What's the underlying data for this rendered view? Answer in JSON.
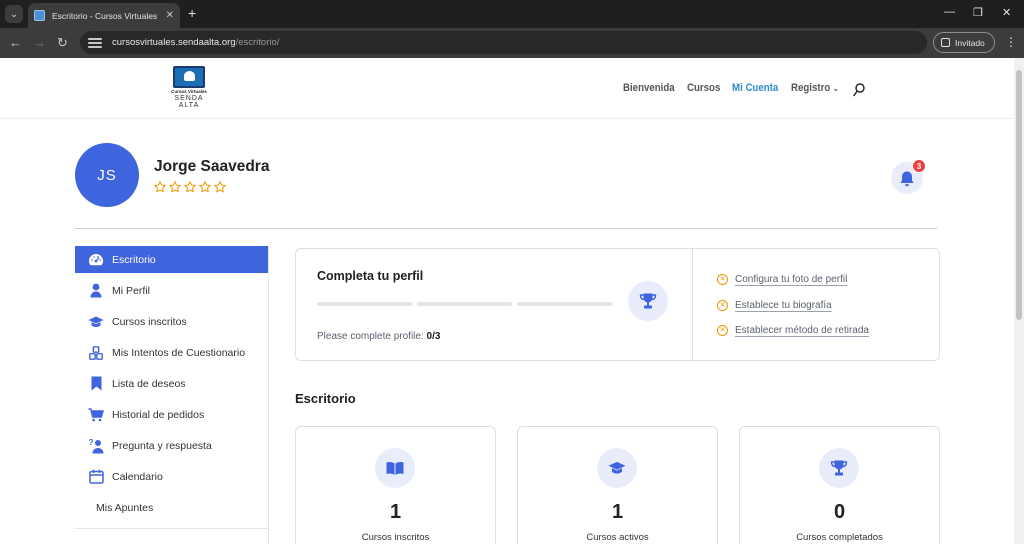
{
  "browser": {
    "tab_title": "Escritorio - Cursos Virtuales Sen",
    "url_host": "cursosvirtuales.sendaalta.org",
    "url_path": "/escritorio/",
    "profile_label": "Invitado"
  },
  "site": {
    "logo_line1": "Cursos Virtuales",
    "logo_line2": "SENDA",
    "logo_line3": "ALTA",
    "menu": [
      "Bienvenida",
      "Cursos",
      "Mi Cuenta",
      "Registro"
    ],
    "active_menu": "Mi Cuenta",
    "accent_color": "#3e64de"
  },
  "user": {
    "initials": "JS",
    "name": "Jorge Saavedra",
    "rating_stars": 0,
    "rating_max": 5,
    "notifications": "3"
  },
  "sidebar": {
    "items": [
      {
        "label": "Escritorio",
        "icon": "dashboard-icon",
        "active": true
      },
      {
        "label": "Mi Perfil",
        "icon": "user-icon"
      },
      {
        "label": "Cursos inscritos",
        "icon": "graduation-cap-icon"
      },
      {
        "label": "Mis Intentos de Cuestionario",
        "icon": "quiz-blocks-icon"
      },
      {
        "label": "Lista de deseos",
        "icon": "bookmark-icon"
      },
      {
        "label": "Historial de pedidos",
        "icon": "cart-icon"
      },
      {
        "label": "Pregunta y respuesta",
        "icon": "question-user-icon"
      },
      {
        "label": "Calendario",
        "icon": "calendar-icon"
      },
      {
        "label": "Mis Apuntes",
        "icon": ""
      }
    ]
  },
  "profile_completion": {
    "title": "Completa tu perfil",
    "status_label": "Please complete profile:",
    "status_value": "0/3",
    "progress_fraction": 0,
    "tasks": [
      "Configura tu foto de perfil",
      "Establece tu biografía",
      "Establecer método de retirada"
    ]
  },
  "dashboard": {
    "title": "Escritorio",
    "stats": [
      {
        "value": "1",
        "label": "Cursos inscritos",
        "icon": "book-icon"
      },
      {
        "value": "1",
        "label": "Cursos activos",
        "icon": "graduation-cap-icon"
      },
      {
        "value": "0",
        "label": "Cursos completados",
        "icon": "trophy-icon"
      }
    ]
  }
}
